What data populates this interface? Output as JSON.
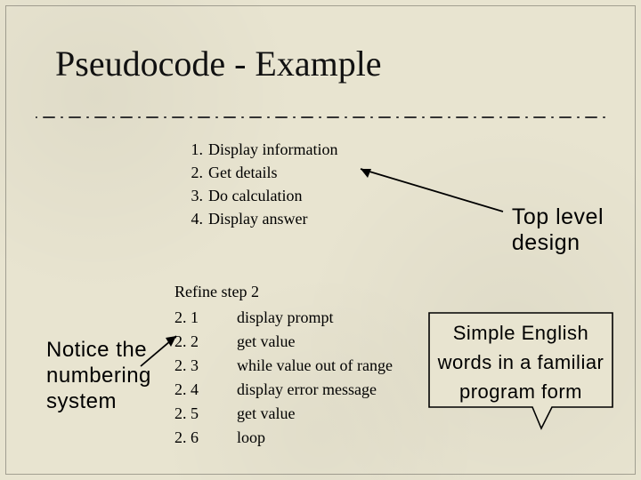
{
  "title": "Pseudocode - Example",
  "topList": [
    {
      "num": "1.",
      "text": "Display information"
    },
    {
      "num": "2.",
      "text": "Get details"
    },
    {
      "num": "3.",
      "text": "Do calculation"
    },
    {
      "num": "4.",
      "text": "Display answer"
    }
  ],
  "refine": {
    "heading": "Refine step 2",
    "rows": [
      {
        "num": "2. 1",
        "text": "display prompt"
      },
      {
        "num": "2. 2",
        "text": "get value"
      },
      {
        "num": "2. 3",
        "text": "while value out of range"
      },
      {
        "num": "2. 4",
        "text": "display error message"
      },
      {
        "num": "2. 5",
        "text": "get value"
      },
      {
        "num": "2. 6",
        "text": "loop"
      }
    ]
  },
  "labels": {
    "topLevel1": "Top level",
    "topLevel2": "design",
    "left1": "Notice the",
    "left2": "numbering",
    "left3": "system",
    "callout1": "Simple English",
    "callout2": "words in a familiar",
    "callout3": "program form"
  },
  "colors": {
    "bg": "#e8e4d0",
    "text": "#000000",
    "calloutFill": "#e8e4d0",
    "calloutStroke": "#000000"
  }
}
